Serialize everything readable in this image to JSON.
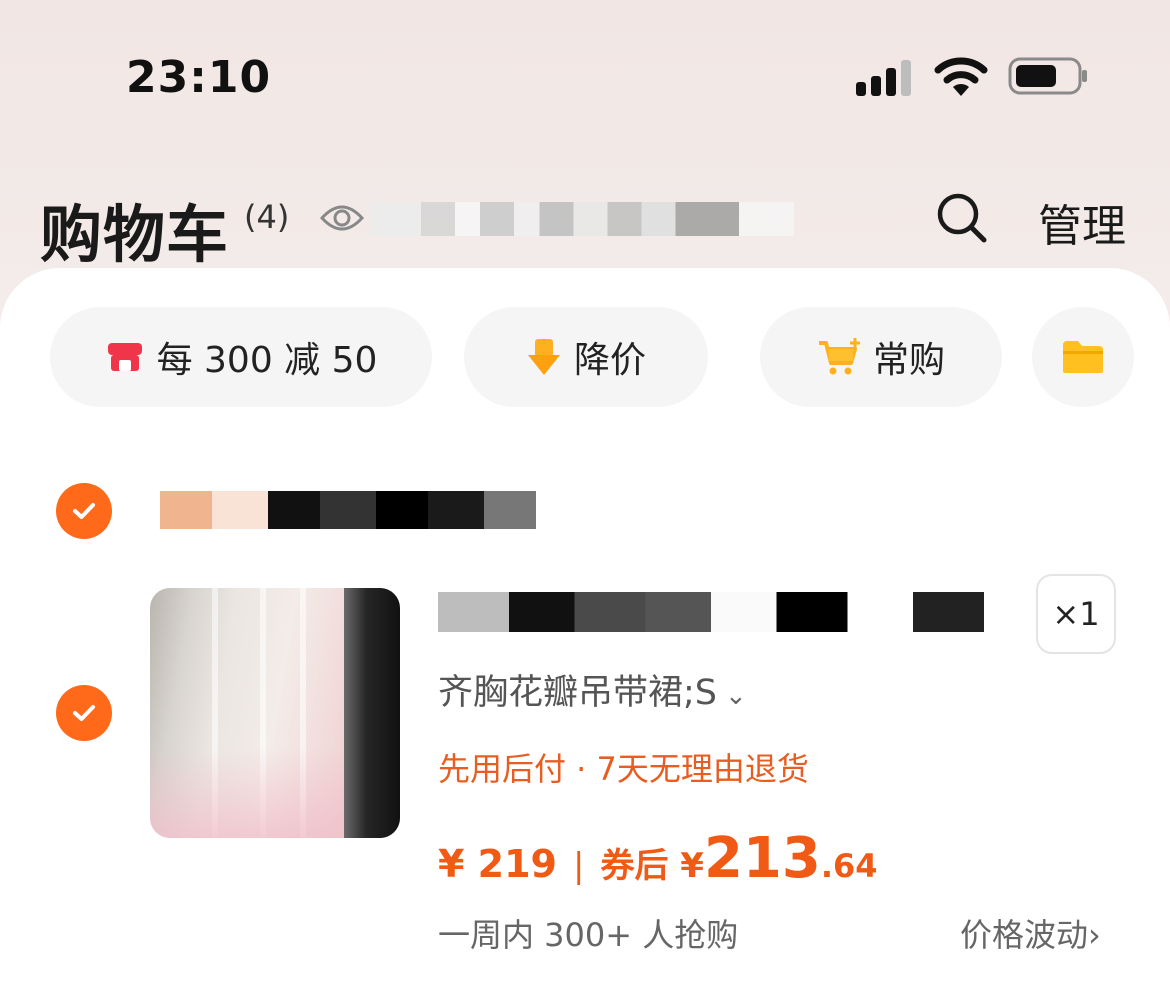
{
  "status_bar": {
    "time": "23:10"
  },
  "header": {
    "title": "购物车",
    "count": "(4)",
    "manage_label": "管理"
  },
  "chips": [
    {
      "label": "每 300 减 50",
      "icon": "store-icon"
    },
    {
      "label": "降价",
      "icon": "arrow-down-icon"
    },
    {
      "label": "常购",
      "icon": "cart-plus-icon"
    },
    {
      "label": "",
      "icon": "folder-icon"
    }
  ],
  "item": {
    "sku": "齐胸花瓣吊带裙;S",
    "quantity": "×1",
    "service": "先用后付 · 7天无理由退货",
    "price": "¥ 219",
    "price_sep": "|",
    "coupon_label": "券后 ¥",
    "coupon_int": "213",
    "coupon_dec": ".64",
    "sales": "一周内 300+ 人抢购",
    "price_trend": "价格波动"
  },
  "colors": {
    "accent": "#ff6a1a",
    "price": "#f05a14",
    "service": "#e85d22"
  }
}
